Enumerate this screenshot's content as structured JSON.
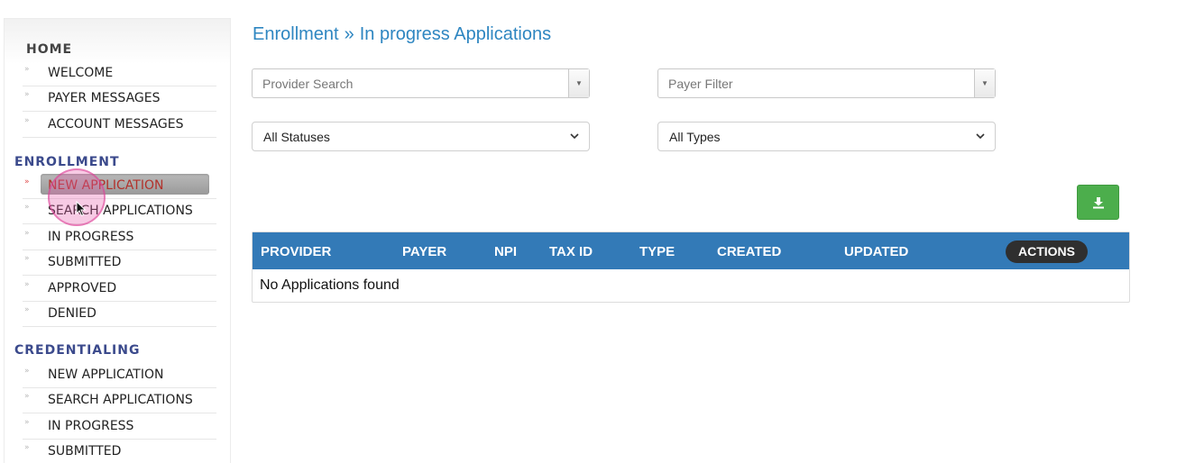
{
  "sidebar": {
    "home": {
      "heading": "HOME",
      "items": [
        {
          "label": "WELCOME"
        },
        {
          "label": "PAYER MESSAGES"
        },
        {
          "label": "ACCOUNT MESSAGES"
        }
      ]
    },
    "enrollment": {
      "heading": "ENROLLMENT",
      "items": [
        {
          "label": "NEW APPLICATION",
          "active": true
        },
        {
          "label": "SEARCH APPLICATIONS"
        },
        {
          "label": "IN PROGRESS"
        },
        {
          "label": "SUBMITTED"
        },
        {
          "label": "APPROVED"
        },
        {
          "label": "DENIED"
        }
      ]
    },
    "credentialing": {
      "heading": "CREDENTIALING",
      "items": [
        {
          "label": "NEW APPLICATION"
        },
        {
          "label": "SEARCH APPLICATIONS"
        },
        {
          "label": "IN PROGRESS"
        },
        {
          "label": "SUBMITTED"
        }
      ]
    },
    "bullet": "»"
  },
  "breadcrumb": {
    "parent": "Enrollment",
    "separator": "»",
    "current": "In progress Applications"
  },
  "filters": {
    "provider_search": {
      "placeholder": "Provider Search"
    },
    "payer_filter": {
      "placeholder": "Payer Filter"
    },
    "status": {
      "selected": "All Statuses"
    },
    "type": {
      "selected": "All Types"
    }
  },
  "download_button": {
    "icon": "download-icon"
  },
  "table": {
    "columns": [
      "PROVIDER",
      "PAYER",
      "NPI",
      "TAX ID",
      "TYPE",
      "CREATED",
      "UPDATED"
    ],
    "actions_label": "ACTIONS",
    "empty_message": "No Applications found"
  },
  "colors": {
    "accent": "#2e86c1",
    "table_header": "#337ab7",
    "section_heading": "#3b4a8c",
    "download_button": "#4cae4c",
    "active_item_text": "#b2322b"
  }
}
